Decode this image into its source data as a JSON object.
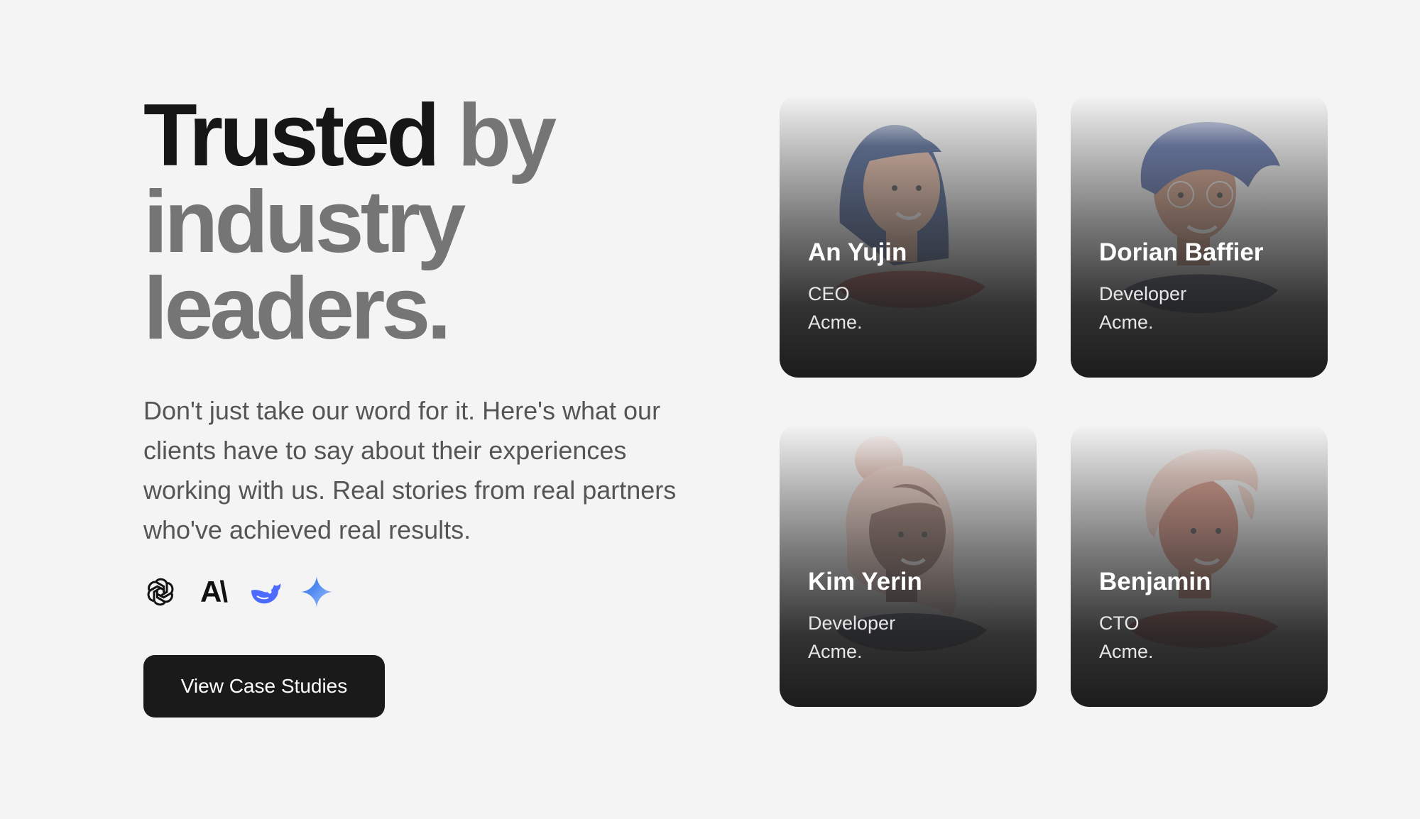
{
  "hero": {
    "headline_strong": "Trusted",
    "headline_rest_1": " by",
    "headline_rest_2": "industry",
    "headline_rest_3": "leaders.",
    "description": "Don't just take our word for it. Here's what our clients have to say about their experiences working with us. Real stories from real partners who've achieved real results.",
    "logos": [
      {
        "icon": "openai-logo-icon"
      },
      {
        "icon": "anthropic-logo-icon",
        "text": "A\\"
      },
      {
        "icon": "deepseek-whale-icon",
        "color": "#4d6bfe"
      },
      {
        "icon": "gemini-sparkle-icon",
        "color": "#3b82f6"
      }
    ],
    "cta_label": "View Case Studies"
  },
  "testimonials": [
    {
      "name": "An Yujin",
      "role": "CEO",
      "company": "Acme."
    },
    {
      "name": "Dorian Baffier",
      "role": "Developer",
      "company": "Acme."
    },
    {
      "name": "Kim Yerin",
      "role": "Developer",
      "company": "Acme."
    },
    {
      "name": "Benjamin",
      "role": "CTO",
      "company": "Acme."
    }
  ],
  "colors": {
    "background": "#f4f4f4",
    "headline_dark": "#161616",
    "headline_muted": "#757575",
    "button_bg": "#1a1a1a"
  }
}
